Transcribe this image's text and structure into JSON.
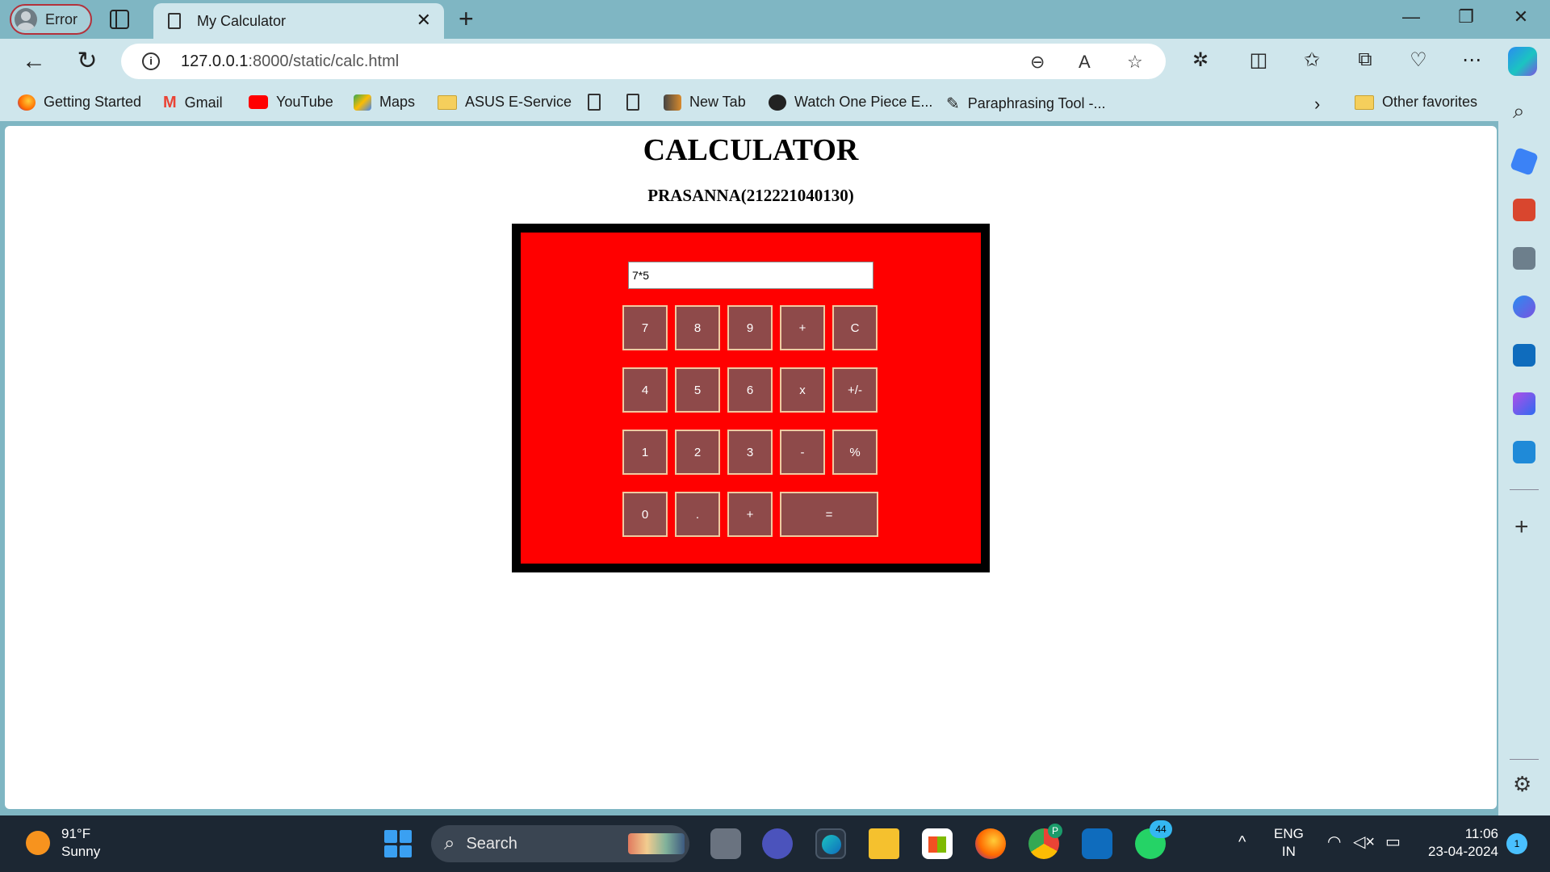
{
  "browser": {
    "profile_label": "Error",
    "tab_title": "My Calculator",
    "address": {
      "host": "127.0.0.1",
      "path": ":8000/static/calc.html"
    },
    "favorites": [
      {
        "label": "Getting Started",
        "icon": "firefox-icon"
      },
      {
        "label": "Gmail",
        "icon": "gmail-icon"
      },
      {
        "label": "YouTube",
        "icon": "youtube-icon"
      },
      {
        "label": "Maps",
        "icon": "maps-icon"
      },
      {
        "label": "ASUS E-Service",
        "icon": "folder-icon"
      },
      {
        "label": "",
        "icon": "file-icon"
      },
      {
        "label": "",
        "icon": "file-icon"
      },
      {
        "label": "New Tab",
        "icon": "newtab-icon"
      },
      {
        "label": "Watch One Piece E...",
        "icon": "one-piece-icon"
      },
      {
        "label": "Paraphrasing Tool -...",
        "icon": "quill-icon"
      }
    ],
    "other_favorites": "Other favorites"
  },
  "page": {
    "title": "CALCULATOR",
    "subtitle": "PRASANNA(212221040130)",
    "display_value": "7*5",
    "keys": [
      [
        "7",
        "8",
        "9",
        "+",
        "C"
      ],
      [
        "4",
        "5",
        "6",
        "x",
        "+/-"
      ],
      [
        "1",
        "2",
        "3",
        "-",
        "%"
      ],
      [
        "0",
        ".",
        "+",
        "="
      ]
    ],
    "colors": {
      "frame": "#000000",
      "panel": "#ff0000",
      "key": "#8e4a4a",
      "key_border": "#f0c9a0"
    }
  },
  "taskbar": {
    "weather_temp": "91°F",
    "weather_desc": "Sunny",
    "search_label": "Search",
    "lang_top": "ENG",
    "lang_bottom": "IN",
    "time": "11:06",
    "date": "23-04-2024",
    "notification_count": "1",
    "whatsapp_badge": "44",
    "chrome_profile_badge": "P"
  }
}
